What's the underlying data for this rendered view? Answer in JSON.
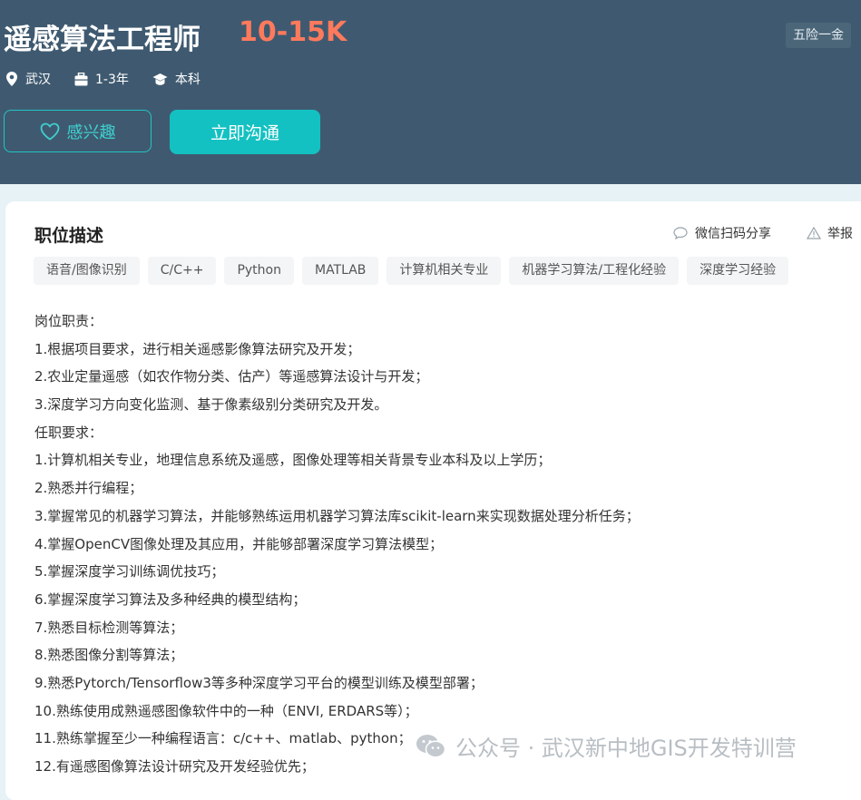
{
  "job": {
    "title": "遥感算法工程师",
    "salary": "10-15K",
    "welfare": "五险一金",
    "meta": {
      "location": "武汉",
      "experience": "1-3年",
      "education": "本科"
    }
  },
  "actions": {
    "interest_label": "感兴趣",
    "chat_label": "立即沟通"
  },
  "description": {
    "title": "职位描述",
    "share_label": "微信扫码分享",
    "report_label": "举报",
    "tags": [
      "语音/图像识别",
      "C/C++",
      "Python",
      "MATLAB",
      "计算机相关专业",
      "机器学习算法/工程化经验",
      "深度学习经验"
    ],
    "lines": [
      "岗位职责：",
      "1.根据项目要求，进行相关遥感影像算法研究及开发；",
      "2.农业定量遥感（如农作物分类、估产）等遥感算法设计与开发；",
      "3.深度学习方向变化监测、基于像素级别分类研究及开发。",
      "任职要求：",
      "1.计算机相关专业，地理信息系统及遥感，图像处理等相关背景专业本科及以上学历；",
      "2.熟悉并行编程；",
      "3.掌握常见的机器学习算法，并能够熟练运用机器学习算法库scikit-learn来实现数据处理分析任务；",
      "4.掌握OpenCV图像处理及其应用，并能够部署深度学习算法模型；",
      "5.掌握深度学习训练调优技巧；",
      "6.掌握深度学习算法及多种经典的模型结构；",
      "7.熟悉目标检测等算法；",
      "8.熟悉图像分割等算法；",
      "9.熟悉Pytorch/Tensorflow3等多种深度学习平台的模型训练及模型部署；",
      "10.熟练使用成熟遥感图像软件中的一种（ENVI, ERDARS等）；",
      "11.熟练掌握至少一种编程语言：c/c++、matlab、python；",
      "12.有遥感图像算法设计研究及开发经验优先；"
    ]
  },
  "watermark": "公众号 · 武汉新中地GIS开发特训营",
  "colors": {
    "header_bg": "#3f5a70",
    "salary": "#fe7a5c",
    "accent": "#14c1c2",
    "page_bg": "#e6f2f5"
  }
}
